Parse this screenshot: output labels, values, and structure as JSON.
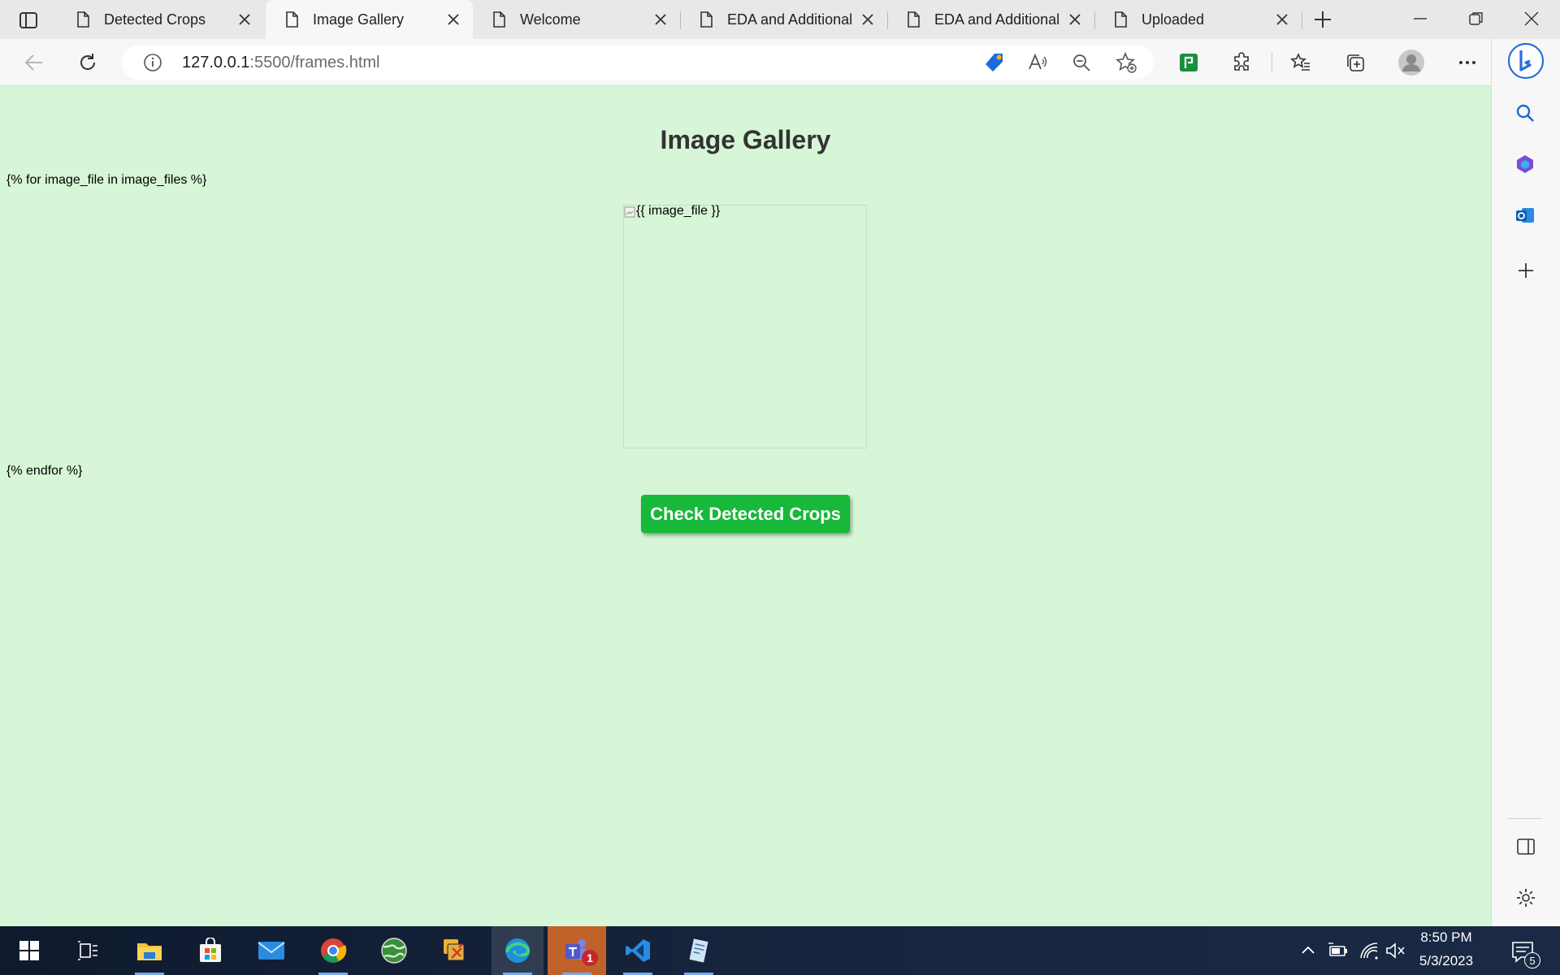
{
  "browser": {
    "tabs": [
      {
        "label": "Detected Crops",
        "active": false
      },
      {
        "label": "Image Gallery",
        "active": true
      },
      {
        "label": "Welcome",
        "active": false
      },
      {
        "label": "EDA and Additional",
        "active": false
      },
      {
        "label": "EDA and Additional",
        "active": false
      },
      {
        "label": "Uploaded",
        "active": false
      }
    ],
    "url_host": "127.0.0.1",
    "url_rest": ":5500/frames.html"
  },
  "page": {
    "title": "Image Gallery",
    "loop_start": "{% for image_file in image_files %}",
    "image_alt": "{{ image_file }}",
    "loop_end": "{% endfor %}",
    "button_label": "Check Detected Crops",
    "background": "#d7f5d7",
    "button_color": "#18b83a"
  },
  "taskbar": {
    "time": "8:50 PM",
    "date": "5/3/2023",
    "teams_badge": "1",
    "notification_count": "5"
  }
}
